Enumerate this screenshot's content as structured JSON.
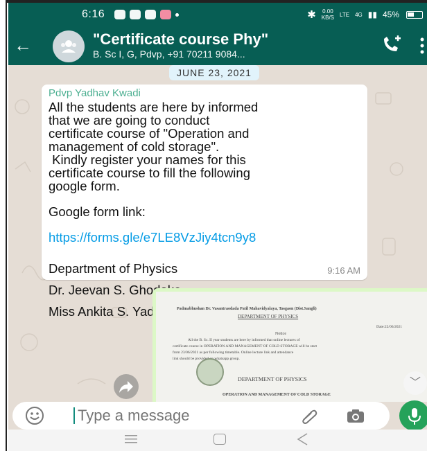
{
  "status_bar": {
    "time": "6:16",
    "speed_value": "0.00",
    "speed_unit": "KB/S",
    "net_label": "LTE",
    "signal_label": "4G",
    "battery": "45%"
  },
  "header": {
    "title": "\"Certificate course Phy\"",
    "subtitle": "B. Sc I, G, Pdvp, +91 70211 9084..."
  },
  "chat": {
    "date_chip": "JUNE 23, 2021",
    "message": {
      "sender": "Pdvp Yadhav Kwadi",
      "lines": [
        "All the students are here by informed",
        "that we are going to conduct",
        "certificate course of \"Operation and",
        "management of cold storage\".",
        " Kindly register your names for this",
        "certificate course to fill the following",
        "google form."
      ],
      "form_label": "Google form link:",
      "link": "https://forms.gle/e7LE8VzJiy4tcn9y8",
      "department": "Department of Physics",
      "signatory_1": "Dr. Jeevan S. Ghodake",
      "signatory_2": "Miss Ankita S. Yadav",
      "time": "9:16 AM"
    },
    "image_doc": {
      "college": "Padmabhushan Dr. Vasantraodada Patil Mahavidyalaya, Tasgaon (Dist.Sangli)",
      "heading": "DEPARTMENT OF PHYSICS",
      "date": "Date:22/06/2021",
      "notice": "Notice",
      "body_1": "All the B. Sc. II year students are here by informed that online lectures of",
      "body_2": "certificate course in OPERATION AND MANAGEMENT OF COLD STORAGE will be start",
      "body_3": "from 23/06/2021 as per following timetable. Online lecture link and attendance",
      "body_4": "link should be provided on whatsapp group.",
      "heading_2": "DEPARTMENT OF PHYSICS",
      "footer": "OPERATION AND MANAGEMENT OF COLD STORAGE"
    }
  },
  "input": {
    "placeholder": "Type a message"
  },
  "colors": {
    "header": "#075e54",
    "chat_bg": "#e5ddd5",
    "link": "#039be5",
    "sender": "#4caf91",
    "mic": "#25a25a"
  }
}
